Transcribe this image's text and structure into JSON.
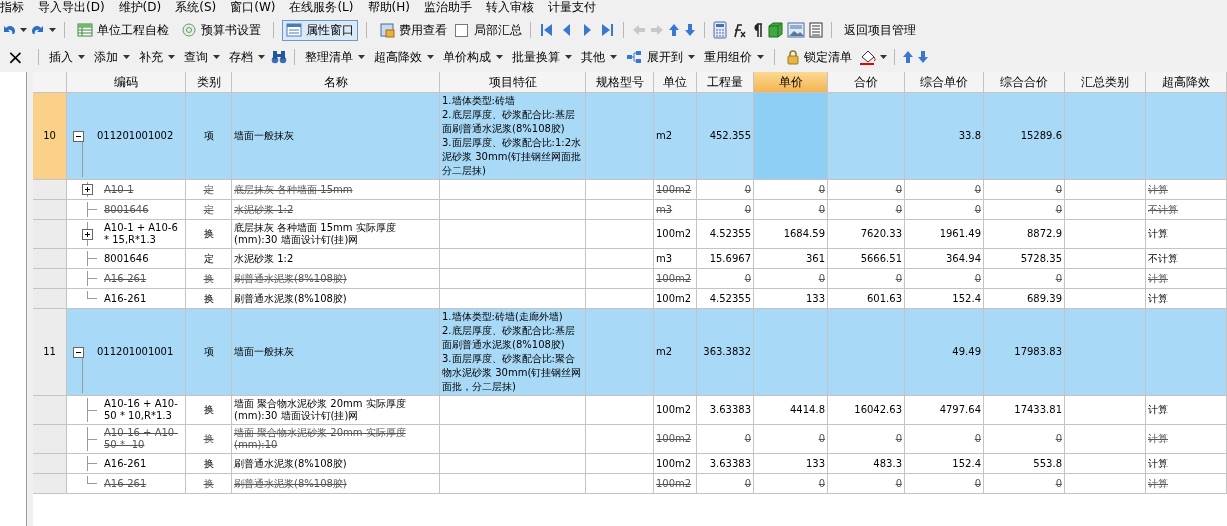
{
  "menu_bar": [
    "指标",
    "导入导出(D)",
    "维护(D)",
    "系统(S)",
    "窗口(W)",
    "在线服务(L)",
    "帮助(H)",
    "监治助手",
    "转入审核",
    "计量支付"
  ],
  "toolbar_1": {
    "buttons": [
      {
        "label": "单位工程自检",
        "selected": false
      },
      {
        "label": "预算书设置",
        "selected": false
      },
      {
        "label": "属性窗口",
        "selected": true
      },
      {
        "label": "费用查看",
        "selected": false
      }
    ],
    "checkbox": {
      "label": "局部汇总",
      "checked": false
    },
    "history_arrows": {
      "disabled": true
    },
    "link": "返回项目管理"
  },
  "toolbar_2": {
    "close": "×",
    "menus": [
      "插入",
      "添加",
      "补充",
      "查询",
      "存档"
    ],
    "menus_2": [
      "整理清单",
      "超高降效",
      "单价构成",
      "批量换算",
      "其他",
      "展开到",
      "重用组价"
    ],
    "lock_button": "锁定清单"
  },
  "table": {
    "columns": [
      {
        "label": "编码",
        "selected": false
      },
      {
        "label": "类别",
        "selected": false
      },
      {
        "label": "名称",
        "selected": false
      },
      {
        "label": "项目特征",
        "selected": false
      },
      {
        "label": "规格型号",
        "selected": false
      },
      {
        "label": "单位",
        "selected": false
      },
      {
        "label": "工程量",
        "selected": false
      },
      {
        "label": "单价",
        "selected": true
      },
      {
        "label": "合价",
        "selected": false
      },
      {
        "label": "综合单价",
        "selected": false
      },
      {
        "label": "综合合价",
        "selected": false
      },
      {
        "label": "汇总类别",
        "selected": false
      },
      {
        "label": "超高降效",
        "selected": false
      }
    ],
    "rows": [
      {
        "kind": "item",
        "number": "10",
        "selected": true,
        "expanded": true,
        "code": "011201001002",
        "type": "项",
        "name": "墙面一般抹灰",
        "features": [
          "1.墙体类型:砖墙",
          "2.底层厚度、砂浆配合比:基层面刷普通水泥浆(8%108胶)",
          "3.面层厚度、砂浆配合比:1:2水泥砂浆 30mm(钉挂钢丝网面批分二层抹)"
        ],
        "unit": "m2",
        "quantity": "452.355",
        "comp_price": "33.8",
        "comp_total": "15289.6"
      },
      {
        "kind": "sub",
        "disabled": true,
        "expanded": false,
        "code": "A10-1",
        "type": "定",
        "name": "底层抹灰 各种墙面 15mm",
        "unit": "100m2",
        "quantity": "0",
        "price": "0",
        "total": "0",
        "comp_price": "0",
        "comp_total": "0",
        "height_effect": "计算"
      },
      {
        "kind": "sub",
        "disabled": true,
        "code": "8001646",
        "type": "定",
        "name": "水泥砂浆 1:2",
        "unit": "m3",
        "quantity": "0",
        "price": "0",
        "total": "0",
        "comp_price": "0",
        "comp_total": "0",
        "height_effect": "不计算"
      },
      {
        "kind": "sub",
        "disabled": false,
        "expanded": false,
        "code": "A10-1 + A10-6 * 15,R*1.3",
        "type": "换",
        "name": "底层抹灰 各种墙面 15mm  实际厚度(mm):30 墙面设计钉(挂)网",
        "unit": "100m2",
        "quantity": "4.52355",
        "price": "1684.59",
        "total": "7620.33",
        "comp_price": "1961.49",
        "comp_total": "8872.9",
        "height_effect": "计算"
      },
      {
        "kind": "sub",
        "disabled": false,
        "code": "8001646",
        "type": "定",
        "name": "水泥砂浆 1:2",
        "unit": "m3",
        "quantity": "15.6967",
        "price": "361",
        "total": "5666.51",
        "comp_price": "364.94",
        "comp_total": "5728.35",
        "height_effect": "不计算"
      },
      {
        "kind": "sub",
        "disabled": true,
        "code": "A16-261",
        "type": "换",
        "name": "刷普通水泥浆(8%108胶)",
        "unit": "100m2",
        "quantity": "0",
        "price": "0",
        "total": "0",
        "comp_price": "0",
        "comp_total": "0",
        "height_effect": "计算"
      },
      {
        "kind": "sub",
        "disabled": false,
        "code": "A16-261",
        "type": "换",
        "name": "刷普通水泥浆(8%108胶)",
        "unit": "100m2",
        "quantity": "4.52355",
        "price": "133",
        "total": "601.63",
        "comp_price": "152.4",
        "comp_total": "689.39",
        "height_effect": "计算"
      },
      {
        "kind": "item",
        "number": "11",
        "selected": false,
        "expanded": true,
        "code": "011201001001",
        "type": "项",
        "name": "墙面一般抹灰",
        "features": [
          "1.墙体类型:砖墙(走廊外墙)",
          "2.底层厚度、砂浆配合比:基层面刷普通水泥浆(8%108胶)",
          "3.面层厚度、砂浆配合比:聚合物水泥砂浆 30mm(钉挂钢丝网面批，分二层抹)"
        ],
        "unit": "m2",
        "quantity": "363.3832",
        "comp_price": "49.49",
        "comp_total": "17983.83"
      },
      {
        "kind": "sub",
        "disabled": false,
        "code": "A10-16 + A10-50 * 10,R*1.3",
        "type": "换",
        "name": "墙面 聚合物水泥砂浆 20mm  实际厚度(mm):30 墙面设计钉(挂)网",
        "unit": "100m2",
        "quantity": "3.63383",
        "price": "4414.8",
        "total": "16042.63",
        "comp_price": "4797.64",
        "comp_total": "17433.81",
        "height_effect": "计算"
      },
      {
        "kind": "sub",
        "disabled": true,
        "code": "A10-16 + A10-50 * -10",
        "type": "换",
        "name": "墙面 聚合物水泥砂浆 20mm 实际厚度(mm):10",
        "unit": "100m2",
        "quantity": "0",
        "price": "0",
        "total": "0",
        "comp_price": "0",
        "comp_total": "0",
        "height_effect": "计算"
      },
      {
        "kind": "sub",
        "disabled": false,
        "code": "A16-261",
        "type": "换",
        "name": "刷普通水泥浆(8%108胶)",
        "unit": "100m2",
        "quantity": "3.63383",
        "price": "133",
        "total": "483.3",
        "comp_price": "152.4",
        "comp_total": "553.8",
        "height_effect": "计算"
      },
      {
        "kind": "sub",
        "disabled": true,
        "code": "A16-261",
        "type": "换",
        "name": "刷普通水泥浆(8%108胶)",
        "unit": "100m2",
        "quantity": "0",
        "price": "0",
        "total": "0",
        "comp_price": "0",
        "comp_total": "0",
        "height_effect": "计算"
      }
    ]
  }
}
